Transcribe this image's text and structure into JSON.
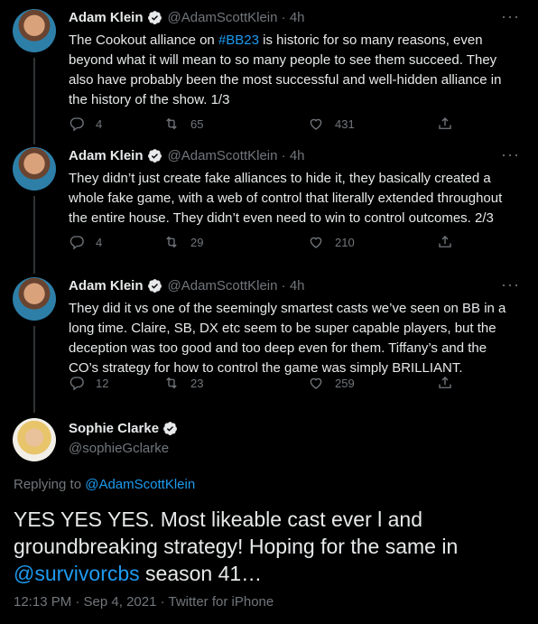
{
  "tweets": [
    {
      "name": "Adam Klein",
      "handle": "@AdamScottKlein",
      "time": "4h",
      "text_before": "The Cookout alliance on ",
      "hashtag": "#BB23",
      "text_after": " is historic for so many reasons, even beyond what it will mean to so many people to see them succeed. They also have probably been the most successful and well-hidden alliance in the history of the show. 1/3",
      "replies": "4",
      "retweets": "65",
      "likes": "431"
    },
    {
      "name": "Adam Klein",
      "handle": "@AdamScottKlein",
      "time": "4h",
      "text": "They didn’t just create fake alliances to hide it, they basically created a whole fake game, with a web of control that literally extended throughout the entire house. They didn’t even need to win to control outcomes. 2/3",
      "replies": "4",
      "retweets": "29",
      "likes": "210"
    },
    {
      "name": "Adam Klein",
      "handle": "@AdamScottKlein",
      "time": "4h",
      "text": "They did it vs one of the seemingly smartest casts we’ve seen on BB in a long time. Claire, SB, DX etc seem to be super capable players, but the deception was too good and too deep even for them. Tiffany’s and the CO’s strategy for how to control the game was simply BRILLIANT.",
      "replies": "12",
      "retweets": "23",
      "likes": "259"
    }
  ],
  "main_tweet": {
    "name": "Sophie Clarke",
    "handle": "@sophieGclarke",
    "replying_label": "Replying to ",
    "replying_to": "@AdamScottKlein",
    "text_before": "YES YES YES. Most likeable cast ever l and groundbreaking strategy! Hoping for the same in ",
    "mention": "@survivorcbs",
    "text_after": " season 41…",
    "meta": "12:13 PM · Sep 4, 2021 · Twitter for iPhone"
  },
  "icons": [
    "verified-badge-icon",
    "more-icon",
    "reply-icon",
    "retweet-icon",
    "like-icon",
    "share-icon"
  ],
  "colors": {
    "background": "#000000",
    "accent": "#1d9bf0",
    "muted": "#71767b",
    "text": "#e7e9ea"
  }
}
